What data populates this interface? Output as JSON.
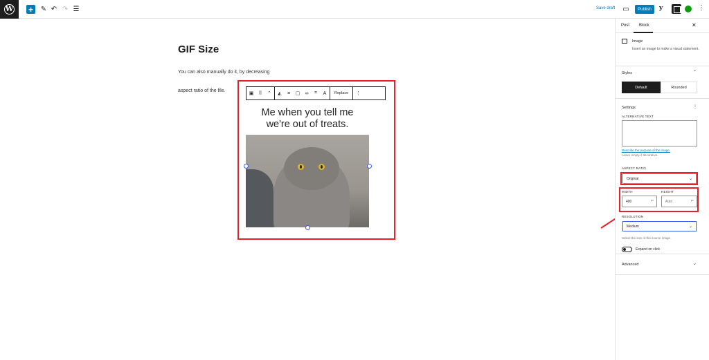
{
  "topbar": {
    "wp_logo": "W",
    "add_icon": "+",
    "edit_icon": "✎",
    "undo_icon": "↶",
    "redo_icon": "↷",
    "list_icon": "☰",
    "save_draft": "Save draft",
    "preview_icon": "▭",
    "publish": "Publish",
    "yoast_icon": "y",
    "more_icon": "⋮"
  },
  "post": {
    "title": "GIF Size",
    "paragraph1": "You can also manually do it, by decreasing",
    "paragraph2": "aspect ratio of the file."
  },
  "image_block": {
    "caption_line1": "Me when you tell me",
    "caption_line2": "we're out of treats.",
    "toolbar": {
      "replace": "Replace",
      "image_icon": "▣",
      "drag_icon": "⠿",
      "move_icon": "⌃",
      "warning_icon": "◭",
      "align_icon": "≡",
      "full_icon": "▢",
      "link_icon": "∞",
      "crop_icon": "⌗",
      "text_icon": "A",
      "options_icon": "⋮"
    }
  },
  "sidebar": {
    "tab_post": "Post",
    "tab_block": "Block",
    "close_icon": "✕",
    "block_name": "Image",
    "block_desc": "Insert an image to make a visual statement.",
    "styles_title": "Styles",
    "style_default": "Default",
    "style_rounded": "Rounded",
    "settings_title": "Settings",
    "settings_more": "⋮",
    "alt_label": "ALTERNATIVE TEXT",
    "alt_link": "Describe the purpose of the image.",
    "alt_help": "Leave empty if decorative.",
    "aspect_label": "ASPECT RATIO",
    "aspect_value": "Original",
    "width_label": "WIDTH",
    "height_label": "HEIGHT",
    "width_value": "400",
    "height_placeholder": "Auto",
    "unit": "px",
    "resolution_label": "RESOLUTION",
    "resolution_value": "Medium",
    "resolution_help": "Select the size of the source image.",
    "expand_label": "Expand on click",
    "advanced_title": "Advanced",
    "chevron_up": "⌃",
    "chevron_down": "⌄"
  },
  "colors": {
    "accent": "#007cba",
    "annotation": "#e5202a",
    "selection": "#3858e9"
  }
}
